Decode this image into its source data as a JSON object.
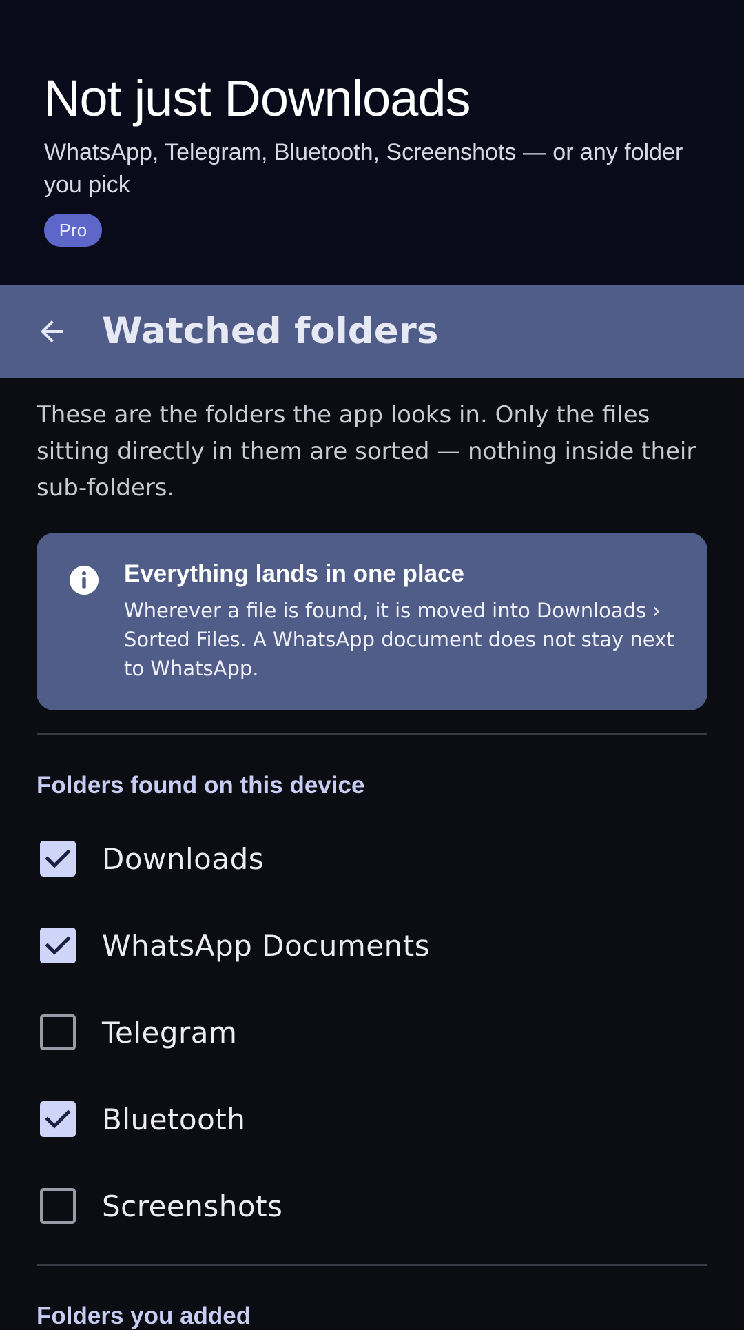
{
  "promo": {
    "title": "Not just Downloads",
    "subtitle": "WhatsApp, Telegram, Bluetooth, Screenshots — or any folder you pick",
    "badge": "Pro"
  },
  "app_bar": {
    "back_icon": "arrow-back-icon",
    "title": "Watched folders"
  },
  "intro": "These are the folders the app looks in. Only the files sitting directly in them are sorted — nothing inside their sub-folders.",
  "info_card": {
    "icon": "info-icon",
    "heading": "Everything lands in one place",
    "body": "Wherever a file is found, it is moved into Downloads › Sorted Files. A WhatsApp document does not stay next to WhatsApp."
  },
  "sections": {
    "found": "Folders found on this device",
    "added": "Folders you added"
  },
  "folders": [
    {
      "label": "Downloads",
      "checked": true
    },
    {
      "label": "WhatsApp Documents",
      "checked": true
    },
    {
      "label": "Telegram",
      "checked": false
    },
    {
      "label": "Bluetooth",
      "checked": true
    },
    {
      "label": "Screenshots",
      "checked": false
    }
  ],
  "colors": {
    "background": "#0c0d12",
    "promo_background": "#0a0b1a",
    "app_bar": "#515d89",
    "accent": "#c6ccf2",
    "badge": "#5c67c9"
  }
}
